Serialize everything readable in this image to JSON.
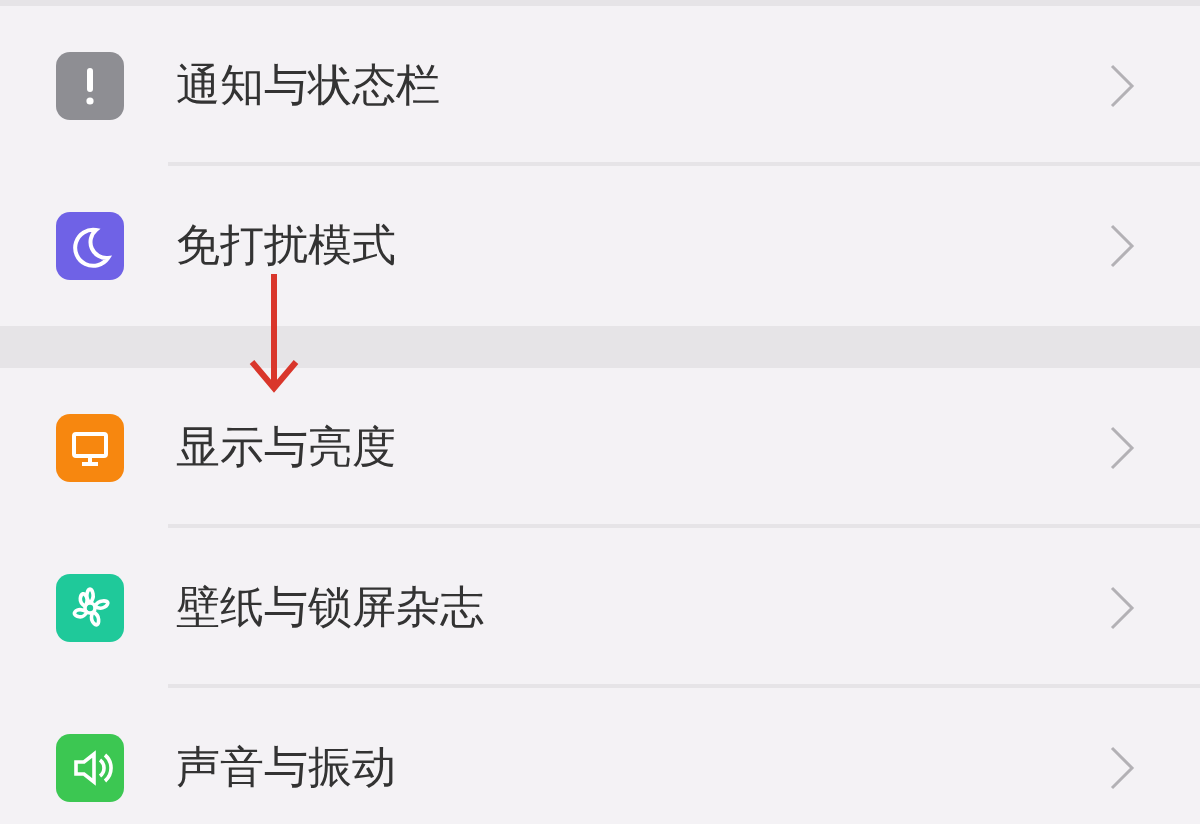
{
  "groups": [
    {
      "items": [
        {
          "label": "通知与状态栏"
        },
        {
          "label": "免打扰模式"
        }
      ]
    },
    {
      "items": [
        {
          "label": "显示与亮度"
        },
        {
          "label": "壁纸与锁屏杂志"
        },
        {
          "label": "声音与振动"
        }
      ]
    }
  ]
}
